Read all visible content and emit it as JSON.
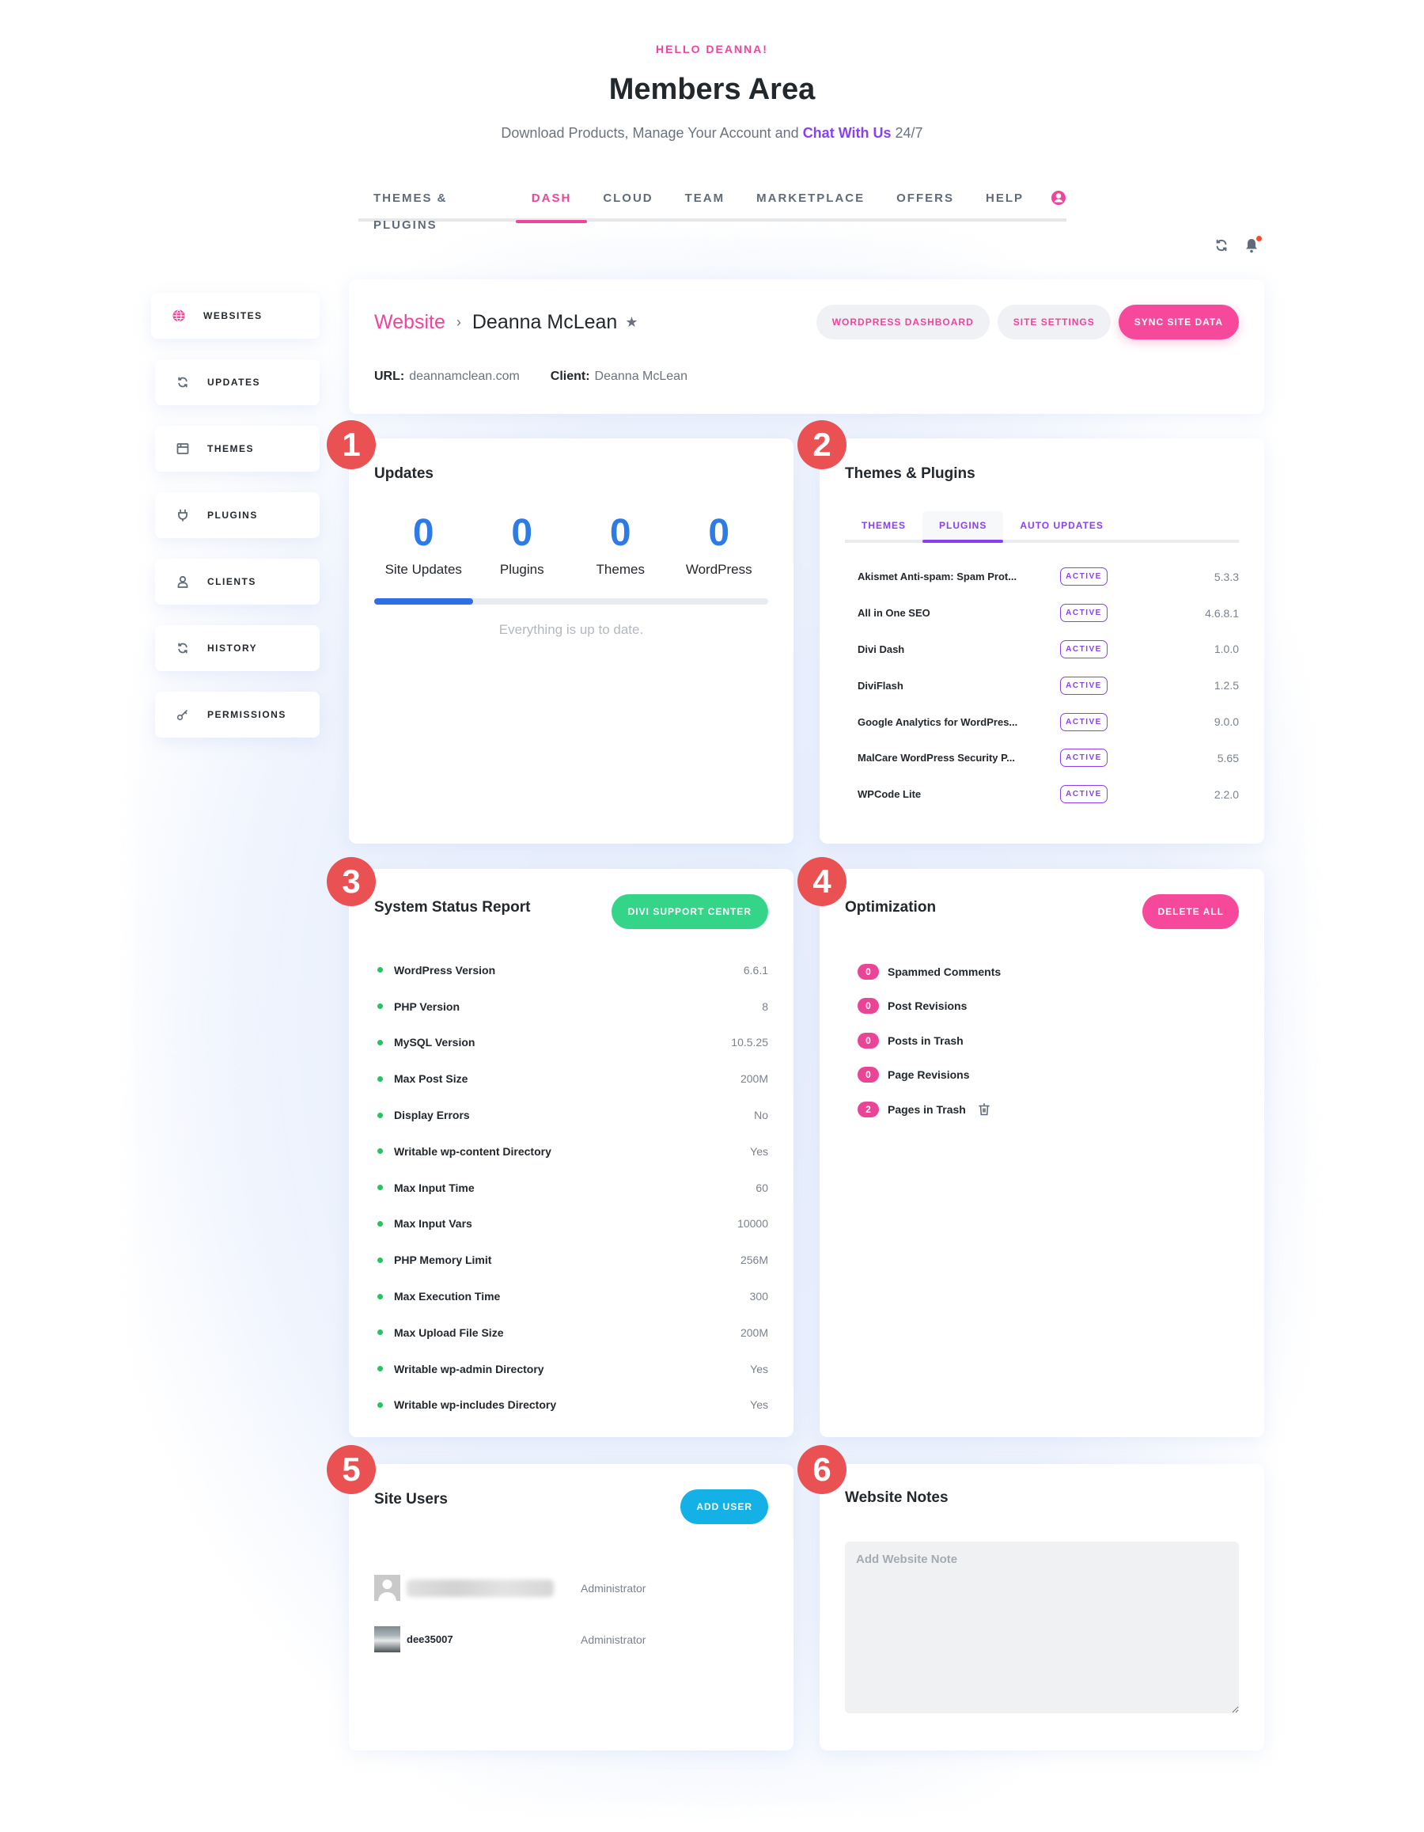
{
  "header": {
    "greeting": "HELLO DEANNA!",
    "title": "Members Area",
    "subtitle_prefix": "Download Products, Manage Your Account and ",
    "subtitle_link": "Chat With Us",
    "subtitle_suffix": " 24/7"
  },
  "topnav": {
    "tabs": [
      {
        "label": "THEMES & PLUGINS",
        "active": false
      },
      {
        "label": "DASH",
        "active": true
      },
      {
        "label": "CLOUD",
        "active": false
      },
      {
        "label": "TEAM",
        "active": false
      },
      {
        "label": "MARKETPLACE",
        "active": false
      },
      {
        "label": "OFFERS",
        "active": false
      },
      {
        "label": "HELP",
        "active": false
      }
    ],
    "account_icon": "user-circle-icon"
  },
  "utility": {
    "refresh_icon": "refresh-icon",
    "notifications_icon": "bell-icon",
    "has_unread": true
  },
  "sidebar": {
    "items": [
      {
        "label": "WEBSITES",
        "icon": "globe-icon",
        "active": true
      },
      {
        "label": "UPDATES",
        "icon": "refresh-icon",
        "active": false
      },
      {
        "label": "THEMES",
        "icon": "window-icon",
        "active": false
      },
      {
        "label": "PLUGINS",
        "icon": "plug-icon",
        "active": false
      },
      {
        "label": "CLIENTS",
        "icon": "user-icon",
        "active": false
      },
      {
        "label": "HISTORY",
        "icon": "refresh-icon",
        "active": false
      },
      {
        "label": "PERMISSIONS",
        "icon": "key-icon",
        "active": false
      }
    ]
  },
  "site": {
    "breadcrumb_root": "Website",
    "breadcrumb_sep": "›",
    "name": "Deanna McLean",
    "url_label": "URL:",
    "url": "deannamclean.com",
    "client_label": "Client:",
    "client": "Deanna McLean",
    "buttons": {
      "wp_dashboard": "WORDPRESS DASHBOARD",
      "site_settings": "SITE SETTINGS",
      "sync": "SYNC SITE DATA"
    }
  },
  "callouts": [
    "1",
    "2",
    "3",
    "4",
    "5",
    "6"
  ],
  "updates": {
    "title": "Updates",
    "stats": [
      {
        "value": "0",
        "label": "Site Updates"
      },
      {
        "value": "0",
        "label": "Plugins"
      },
      {
        "value": "0",
        "label": "Themes"
      },
      {
        "value": "0",
        "label": "WordPress"
      }
    ],
    "progress_percent": 25,
    "status": "Everything is up to date."
  },
  "themes_plugins": {
    "title": "Themes & Plugins",
    "tabs": [
      {
        "label": "THEMES",
        "active": false
      },
      {
        "label": "PLUGINS",
        "active": true
      },
      {
        "label": "AUTO UPDATES",
        "active": false
      }
    ],
    "plugins": [
      {
        "name": "Akismet Anti-spam: Spam Prot...",
        "status": "ACTIVE",
        "version": "5.3.3"
      },
      {
        "name": "All in One SEO",
        "status": "ACTIVE",
        "version": "4.6.8.1"
      },
      {
        "name": "Divi Dash",
        "status": "ACTIVE",
        "version": "1.0.0"
      },
      {
        "name": "DiviFlash",
        "status": "ACTIVE",
        "version": "1.2.5"
      },
      {
        "name": "Google Analytics for WordPres...",
        "status": "ACTIVE",
        "version": "9.0.0"
      },
      {
        "name": "MalCare WordPress Security P...",
        "status": "ACTIVE",
        "version": "5.65"
      },
      {
        "name": "WPCode Lite",
        "status": "ACTIVE",
        "version": "2.2.0"
      }
    ]
  },
  "system_status": {
    "title": "System Status Report",
    "button": "DIVI SUPPORT CENTER",
    "rows": [
      {
        "key": "WordPress Version",
        "value": "6.6.1"
      },
      {
        "key": "PHP Version",
        "value": "8"
      },
      {
        "key": "MySQL Version",
        "value": "10.5.25"
      },
      {
        "key": "Max Post Size",
        "value": "200M"
      },
      {
        "key": "Display Errors",
        "value": "No"
      },
      {
        "key": "Writable wp-content Directory",
        "value": "Yes"
      },
      {
        "key": "Max Input Time",
        "value": "60"
      },
      {
        "key": "Max Input Vars",
        "value": "10000"
      },
      {
        "key": "PHP Memory Limit",
        "value": "256M"
      },
      {
        "key": "Max Execution Time",
        "value": "300"
      },
      {
        "key": "Max Upload File Size",
        "value": "200M"
      },
      {
        "key": "Writable wp-admin Directory",
        "value": "Yes"
      },
      {
        "key": "Writable wp-includes Directory",
        "value": "Yes"
      }
    ]
  },
  "optimization": {
    "title": "Optimization",
    "button": "DELETE ALL",
    "rows": [
      {
        "count": "0",
        "label": "Spammed Comments",
        "deletable": false
      },
      {
        "count": "0",
        "label": "Post Revisions",
        "deletable": false
      },
      {
        "count": "0",
        "label": "Posts in Trash",
        "deletable": false
      },
      {
        "count": "0",
        "label": "Page Revisions",
        "deletable": false
      },
      {
        "count": "2",
        "label": "Pages in Trash",
        "deletable": true
      }
    ]
  },
  "site_users": {
    "title": "Site Users",
    "button": "ADD USER",
    "users": [
      {
        "name": "",
        "name_blurred": true,
        "role": "Administrator",
        "avatar": "default"
      },
      {
        "name": "dee35007",
        "name_blurred": false,
        "role": "Administrator",
        "avatar": "photo"
      }
    ]
  },
  "notes": {
    "title": "Website Notes",
    "placeholder": "Add Website Note",
    "value": ""
  },
  "colors": {
    "brand_pink": "#f0449b",
    "purple": "#8a3ff5",
    "blue": "#2f7be6",
    "green": "#34d489",
    "cyan": "#14b1e7",
    "callout_red": "#ea5153"
  }
}
